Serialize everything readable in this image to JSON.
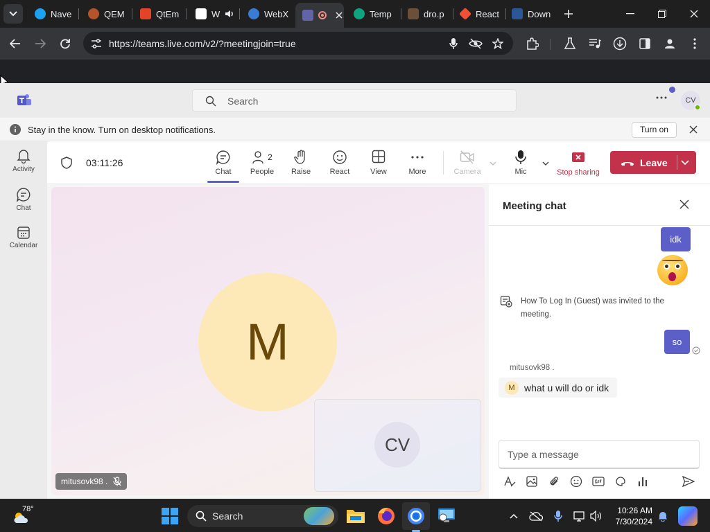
{
  "browser": {
    "tabs": [
      {
        "label": "Nave",
        "color": "#1da1f2"
      },
      {
        "label": "QEM",
        "color": "#b3542b"
      },
      {
        "label": "QtEm",
        "color": "#e24329"
      },
      {
        "label": "W",
        "color": "#ffffff"
      },
      {
        "label": "WebX",
        "color": "#3a7bd5"
      },
      {
        "label": "",
        "color": "#6264a7"
      },
      {
        "label": "Temp",
        "color": "#10a37f"
      },
      {
        "label": "dro.p",
        "color": "#6b4f3a"
      },
      {
        "label": "React",
        "color": "#f05033"
      },
      {
        "label": "Down",
        "color": "#2b5797"
      }
    ],
    "url": "https://teams.live.com/v2/?meetingjoin=true"
  },
  "teams": {
    "search_placeholder": "Search",
    "user_initials": "CV",
    "notification": {
      "text": "Stay in the know. Turn on desktop notifications.",
      "button": "Turn on"
    },
    "rail": [
      {
        "label": "Activity",
        "icon": "bell-icon"
      },
      {
        "label": "Chat",
        "icon": "chat-icon"
      },
      {
        "label": "Calendar",
        "icon": "calendar-icon"
      }
    ],
    "meeting": {
      "timer": "03:11:26",
      "controls": {
        "chat": "Chat",
        "people": "People",
        "people_count": "2",
        "raise": "Raise",
        "react": "React",
        "view": "View",
        "more": "More",
        "camera": "Camera",
        "mic": "Mic",
        "stop_sharing": "Stop sharing",
        "leave": "Leave"
      },
      "main_participant_initial": "M",
      "self_initials": "CV",
      "participant_name": "mitusovk98 ."
    },
    "chat_panel": {
      "title": "Meeting chat",
      "messages": {
        "me_1": "idk",
        "me_emoji": "😮",
        "system": "How To Log In (Guest) was invited to the meeting.",
        "me_2": "so",
        "their_sender": "mitusovk98 .",
        "their_initial": "M",
        "their_text": "what u will do or idk"
      },
      "compose_placeholder": "Type a message"
    }
  },
  "taskbar": {
    "weather_temp": "78°",
    "search_label": "Search",
    "time": "10:26 AM",
    "date": "7/30/2024"
  },
  "colors": {
    "teams_purple": "#5b5fc7",
    "leave_red": "#c4314b",
    "stop_sharing_red": "#c4314b"
  }
}
